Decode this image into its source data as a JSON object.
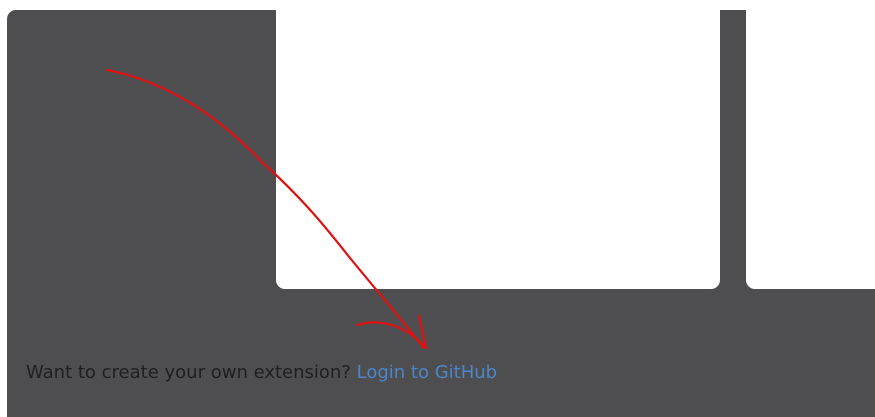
{
  "footer": {
    "prompt_text": "Want to create your own extension?",
    "link_label": "Login to GitHub"
  },
  "colors": {
    "panel_background": "#4e4e50",
    "card_background": "#ffffff",
    "link": "#4a86c8",
    "annotation_arrow": "#e01010"
  },
  "annotation": {
    "icon": "hand-drawn-arrow-icon"
  }
}
